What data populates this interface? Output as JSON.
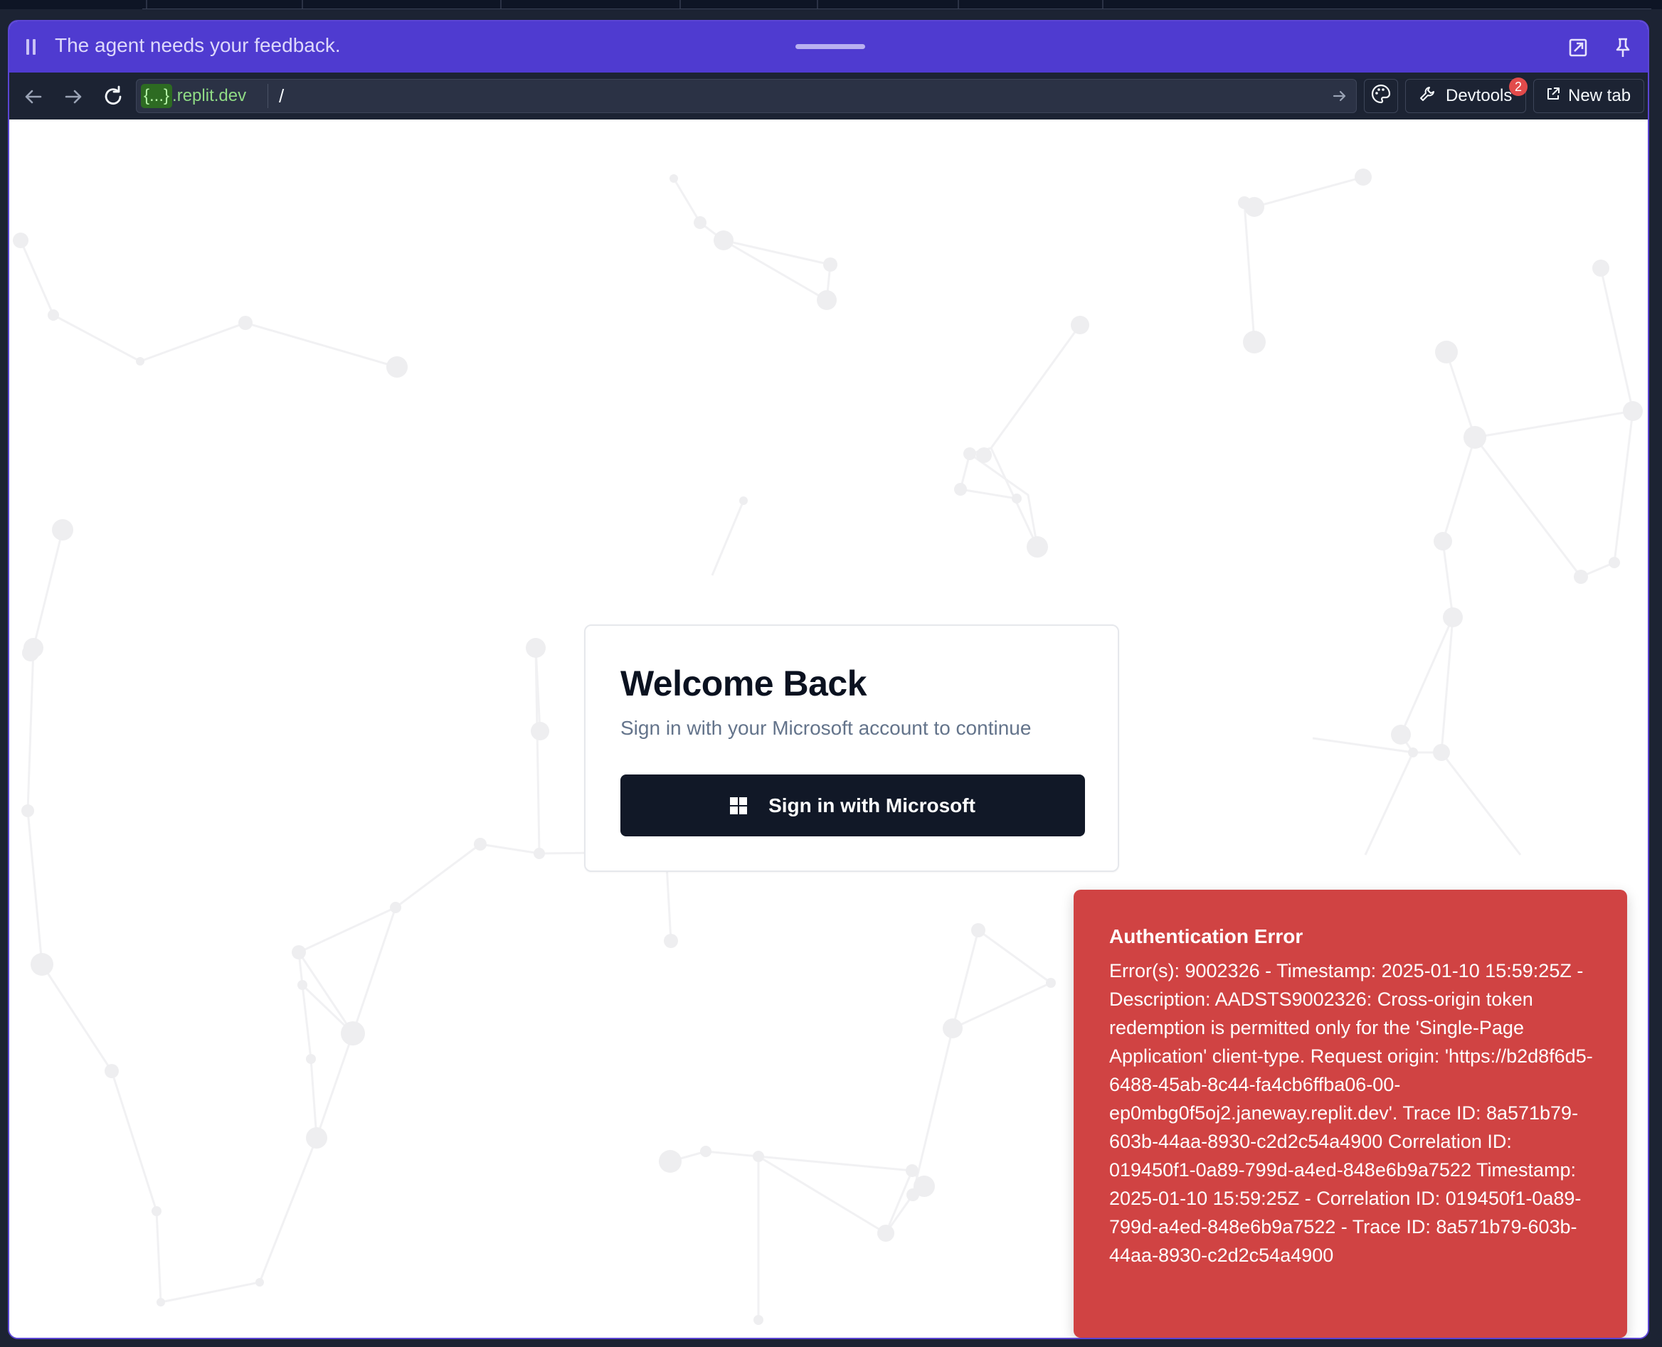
{
  "feedback_bar": {
    "message": "The agent needs your feedback.",
    "icons": [
      "pause-icon",
      "drag-handle",
      "open-external-icon",
      "pin-icon"
    ]
  },
  "browser_bar": {
    "url_chip": "{...}",
    "url_domain": ".replit.dev",
    "url_path": "/",
    "devtools_label": "Devtools",
    "devtools_badge": "2",
    "new_tab_label": "New tab",
    "icons": [
      "back-arrow-icon",
      "forward-arrow-icon",
      "reload-icon",
      "go-arrow-icon",
      "palette-icon",
      "wrench-icon",
      "external-link-icon"
    ]
  },
  "login": {
    "title": "Welcome Back",
    "subtitle": "Sign in with your Microsoft account to continue",
    "button_label": "Sign in with Microsoft",
    "button_icon": "windows-logo-icon"
  },
  "error_toast": {
    "title": "Authentication Error",
    "message": "Error(s): 9002326 - Timestamp: 2025-01-10 15:59:25Z - Description: AADSTS9002326: Cross-origin token redemption is permitted only for the 'Single-Page Application' client-type. Request origin: 'https://b2d8f6d5-6488-45ab-8c44-fa4cb6ffba06-00-ep0mbg0f5oj2.janeway.replit.dev'. Trace ID: 8a571b79-603b-44aa-8930-c2d2c54a4900 Correlation ID: 019450f1-0a89-799d-a4ed-848e6b9a7522 Timestamp: 2025-01-10 15:59:25Z - Correlation ID: 019450f1-0a89-799d-a4ed-848e6b9a7522 - Trace ID: 8a571b79-603b-44aa-8930-c2d2c54a4900"
  },
  "colors": {
    "feedback_bar": "#4f3bd0",
    "browser_chrome": "#1c2333",
    "error_background": "#d04343",
    "primary_button": "#111827"
  }
}
